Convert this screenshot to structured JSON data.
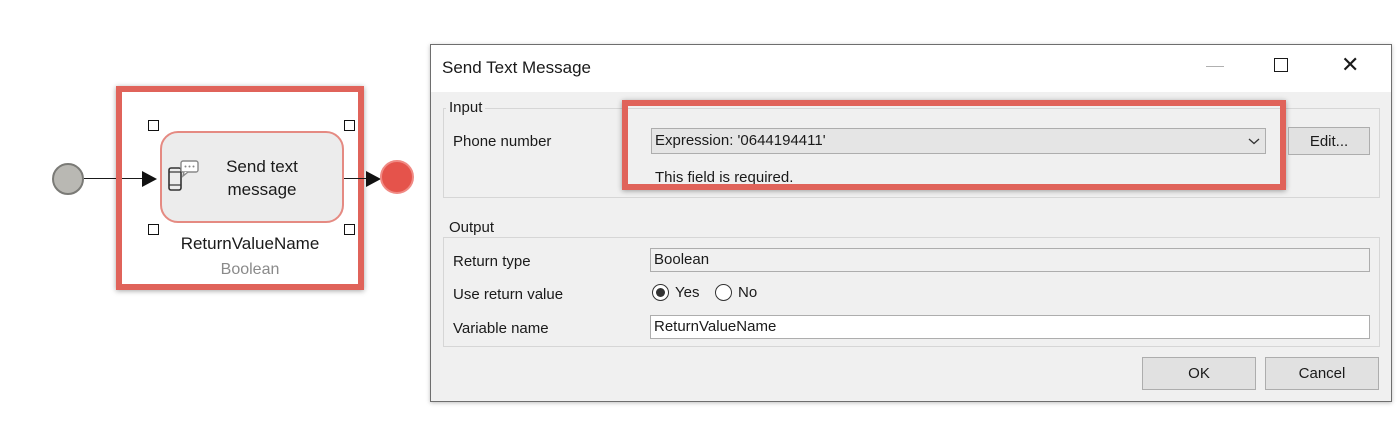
{
  "diagram": {
    "activity": {
      "label_line1": "Send text",
      "label_line2": "message",
      "icon": "phone-message-icon"
    },
    "variable_name": "ReturnValueName",
    "variable_type": "Boolean",
    "highlight_color": "#e0635a",
    "start_event_color": "#b9b8b3",
    "end_event_color": "#e5534b"
  },
  "dialog": {
    "title": "Send Text Message",
    "window_buttons": [
      "minimize-icon",
      "maximize-icon",
      "close-icon"
    ],
    "input_group": {
      "title": "Input",
      "phone_label": "Phone number",
      "phone_value": "Expression: '0644194411'",
      "edit_button": "Edit...",
      "error": "This field is required."
    },
    "output_group": {
      "title": "Output",
      "return_type_label": "Return type",
      "return_type_value": "Boolean",
      "use_return_label": "Use return value",
      "yes_label": "Yes",
      "no_label": "No",
      "selected": "Yes",
      "variable_label": "Variable name",
      "variable_value": "ReturnValueName"
    },
    "ok_button": "OK",
    "cancel_button": "Cancel"
  }
}
